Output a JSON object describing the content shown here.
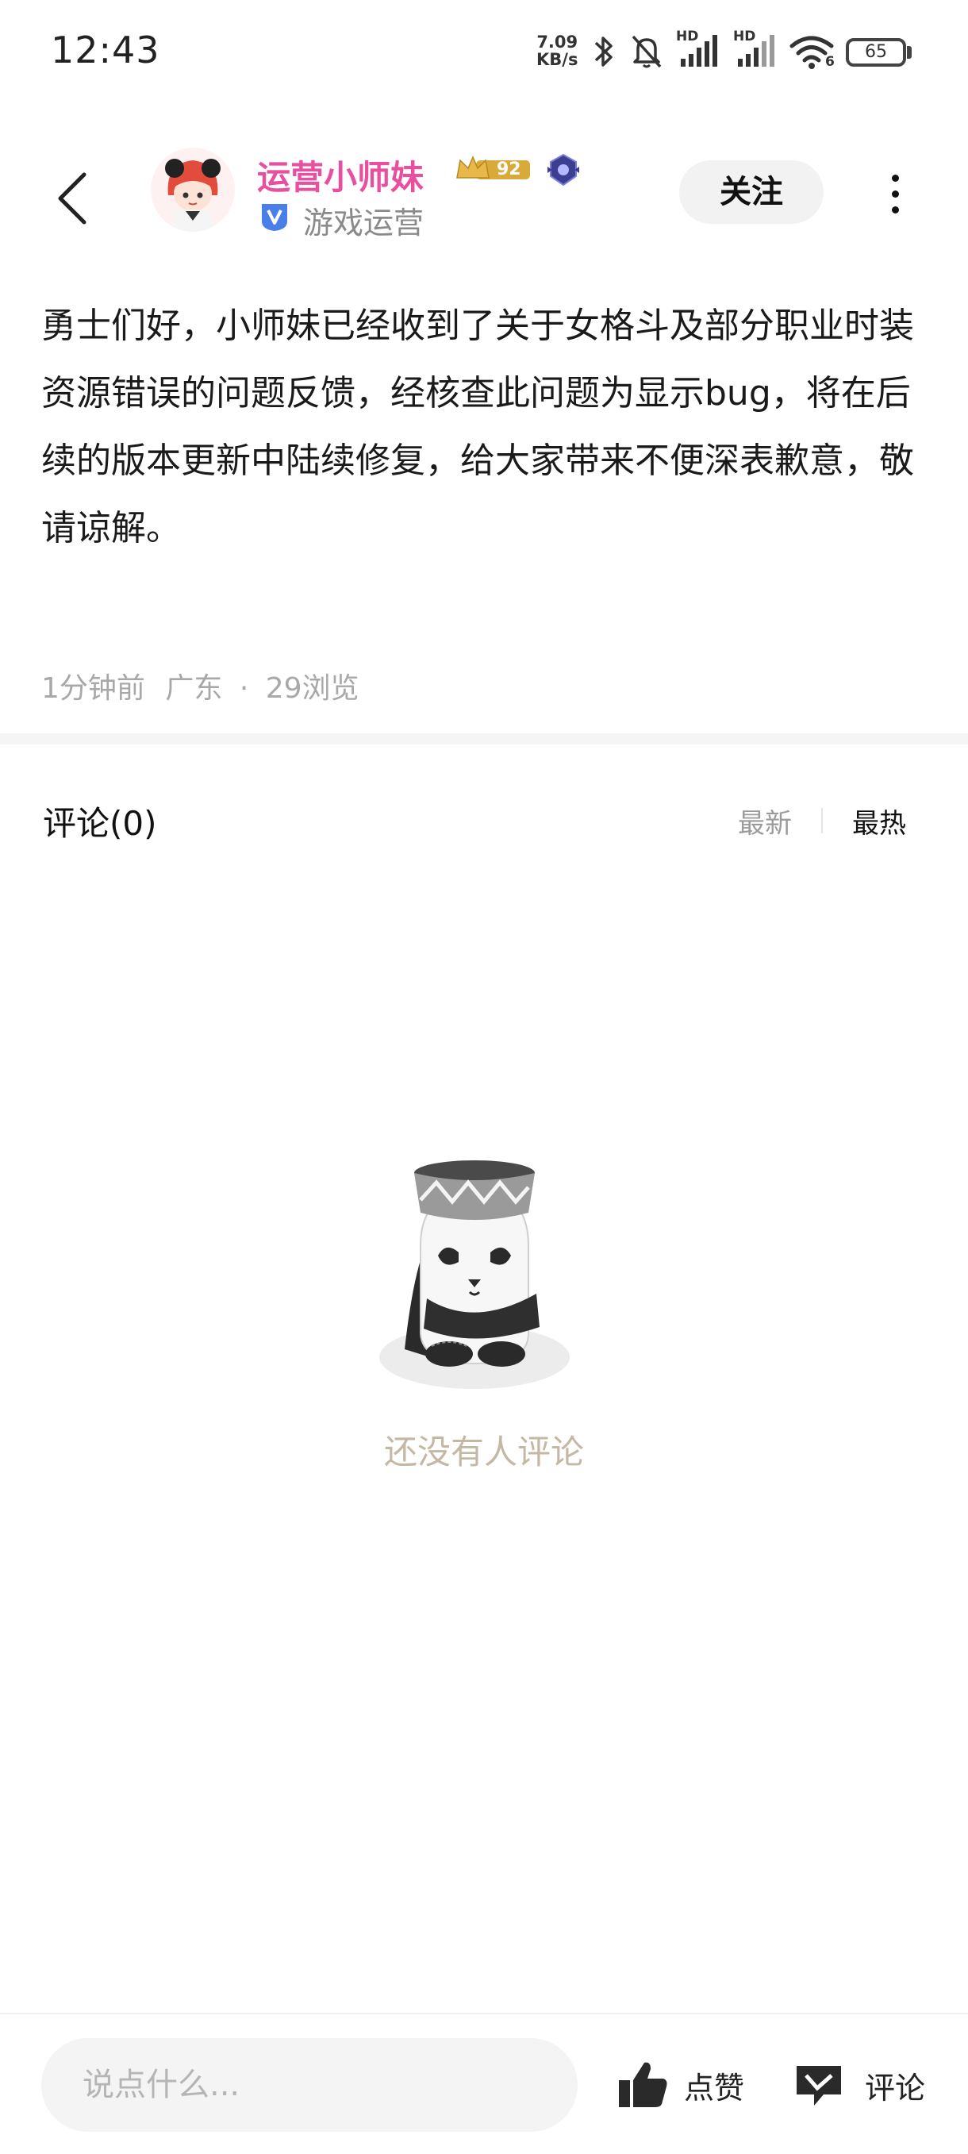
{
  "status_bar": {
    "time": "12:43",
    "net_speed_value": "7.09",
    "net_speed_unit": "KB/s",
    "hd_label_1": "HD",
    "hd_label_2": "HD",
    "wifi_label": "6",
    "battery": "65"
  },
  "header": {
    "author_name": "运营小师妹",
    "level": "92",
    "author_role": "游戏运营",
    "follow_label": "关注"
  },
  "post": {
    "body": "勇士们好，小师妹已经收到了关于女格斗及部分职业时装资源错误的问题反馈，经核查此问题为显示bug，将在后续的版本更新中陆续修复，给大家带来不便深表歉意，敬请谅解。",
    "time_ago": "1分钟前",
    "location": "广东",
    "separator": "·",
    "views": "29浏览"
  },
  "comments": {
    "title": "评论(0)",
    "sort_newest": "最新",
    "sort_hot": "最热",
    "empty_text": "还没有人评论"
  },
  "bottom_bar": {
    "input_placeholder": "说点什么...",
    "like_label": "点赞",
    "comment_label": "评论"
  },
  "colors": {
    "author_name": "#e8509f",
    "empty_text": "#c4b8a4",
    "verified": "#4a7ee8"
  }
}
